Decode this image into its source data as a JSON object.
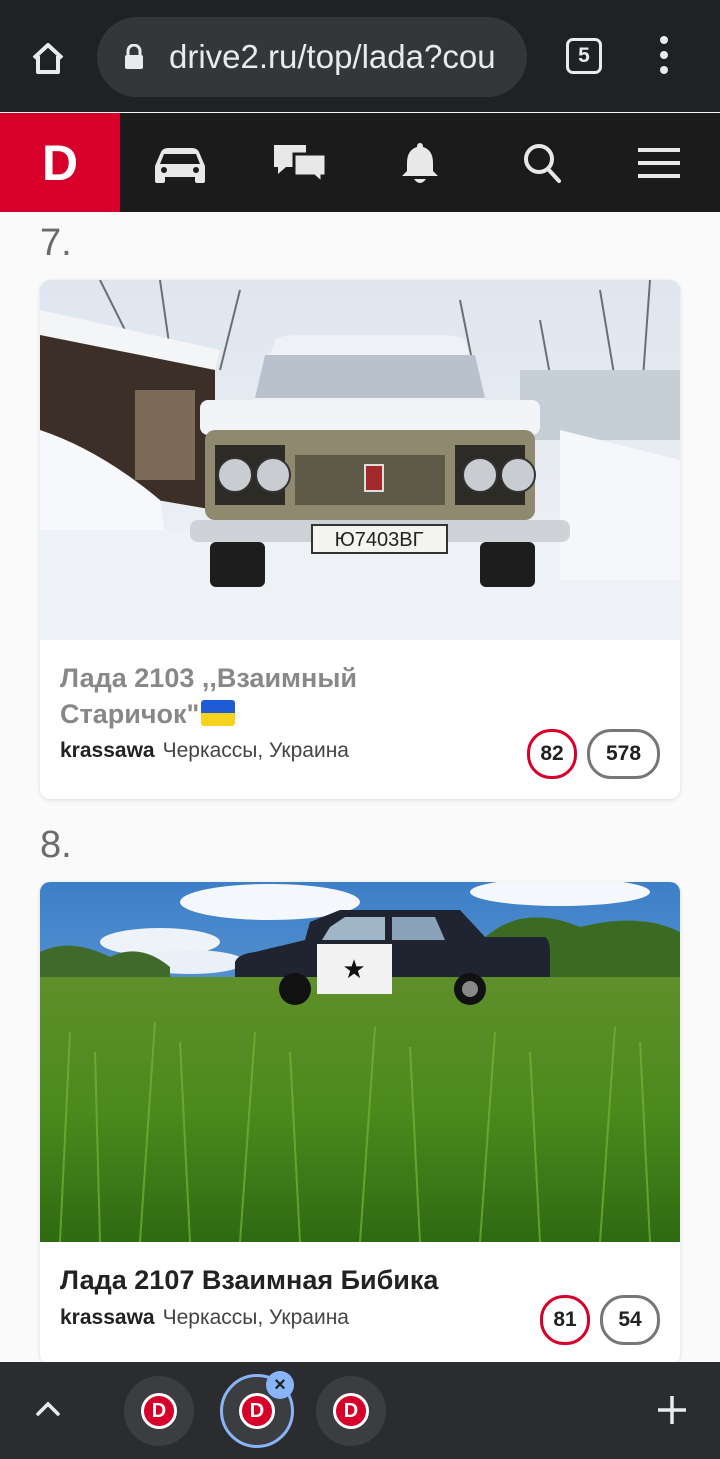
{
  "browser": {
    "url": "drive2.ru/top/lada?cou",
    "tab_count": "5"
  },
  "site": {
    "logo": "D",
    "brand_color": "#d6002a",
    "nav_icons": [
      "car-icon",
      "chat-icon",
      "bell-icon",
      "search-icon",
      "hamburger-icon"
    ]
  },
  "entries": [
    {
      "rank": "7.",
      "title_line1": "Лада 2103 ,,Взаимный",
      "title_line2": "Старичок\"",
      "title_flag": "ukraine-flag",
      "author": "krassawa",
      "location": "Черкассы, Украина",
      "score": "82",
      "count": "578",
      "photo": "Snowy Lada 2103 with plate Ю7403ВГ"
    },
    {
      "rank": "8.",
      "title": "Лада 2107 Взаимная Бибика",
      "author": "krassawa",
      "location": "Черкассы, Украина",
      "score": "81",
      "count": "54",
      "photo": "Lada 2107 in green grass"
    }
  ],
  "bottom_tabs": {
    "favicon_letter": "D",
    "close": "×",
    "add": "+"
  }
}
